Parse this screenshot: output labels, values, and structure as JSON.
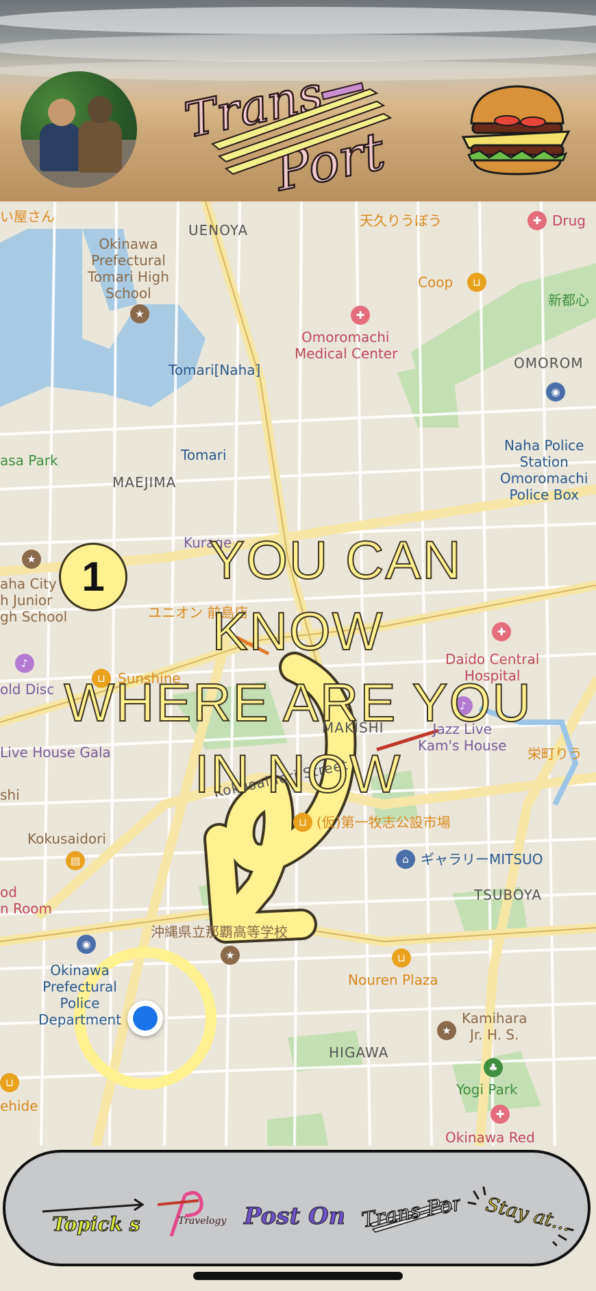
{
  "header": {
    "logo_line1": "Trans",
    "logo_line2": "Port",
    "avatar": "profile-photo",
    "menu_icon": "hamburger-burger-icon"
  },
  "map": {
    "labels": {
      "okinawa_pref_tomari": [
        "Okinawa",
        "Prefectural",
        "Tomari High",
        "School"
      ],
      "uenoya": "UENOYA",
      "tenkuri": "天久りうぼう",
      "drug": "Drug",
      "coop": "Coop",
      "shintoshin": "新都心",
      "omoromachi": "Omoromachi",
      "medical_center": "Medical Center",
      "omorom": "OMOROM",
      "tomari": "Tomari[Naha]",
      "naha_police": [
        "Naha Police",
        "Station",
        "Omoromachi",
        "Police Box"
      ],
      "asa_park": "asa Park",
      "maejima": "MAEJIMA",
      "tomari2": "Tomari",
      "kurage": "Kurage",
      "yasan": "い屋さん",
      "aha_city": [
        "aha City",
        "h Junior",
        "gh School"
      ],
      "union": "ユニオン 前島店",
      "old_disc": "old Disc",
      "sunshine": "Sunshine",
      "daido": [
        "Daido Central",
        "Hospital"
      ],
      "makishi": "MAKISHI",
      "jazz": [
        "Jazz Live",
        "Kam's House"
      ],
      "sakaemachi": "栄町りう",
      "live_house": "Live House Gala",
      "shi": "shi",
      "kokusai_street": "Kokusaidori Street",
      "kokusaidori": "Kokusaidori",
      "market": "(仮)第一牧志公設市場",
      "gallery": "ギャラリーMITSUO",
      "od_room": [
        "od",
        "n Room"
      ],
      "tsuboya": "TSUBOYA",
      "naha_high": "沖縄県立那覇高等学校",
      "okinawa_police": [
        "Okinawa",
        "Prefectural",
        "Police",
        "Department"
      ],
      "nouren": "Nouren Plaza",
      "kamihara": [
        "Kamihara",
        "Jr. H. S."
      ],
      "higawa": "HIGAWA",
      "yogi": "Yogi Park",
      "ehide": "ehide",
      "okinawa_red": "Okinawa Red"
    },
    "headline": [
      "YOU CAN",
      "KNOW",
      "WHERE ARE YOU",
      "IN NOW"
    ],
    "step_number": "1",
    "location_marker": "current-location"
  },
  "nav": {
    "items": [
      "Topick s",
      "Travelogy",
      "Post On",
      "Trans Port",
      "Stay at..."
    ]
  },
  "colors": {
    "highlight_yellow": "#fff18f",
    "location_blue": "#1a73e8",
    "nav_bg": "#c8c9cb"
  }
}
